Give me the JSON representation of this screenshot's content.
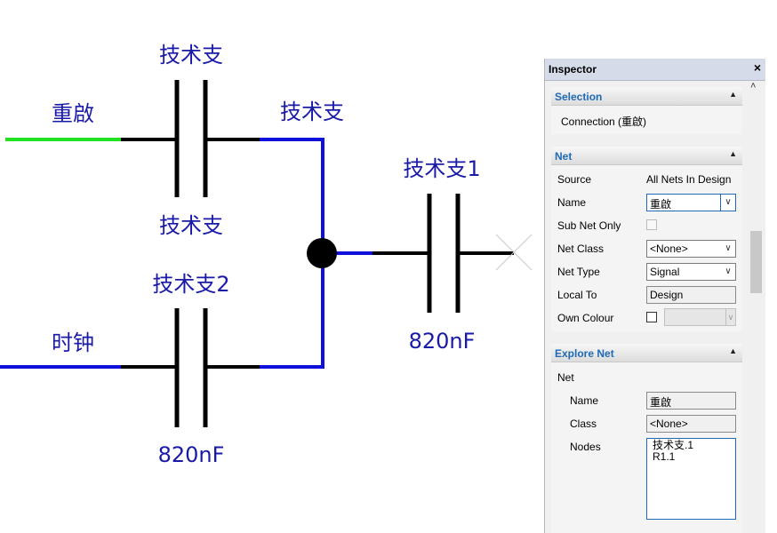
{
  "schematic": {
    "labels": {
      "top_cap_ref": "技术支",
      "top_cap_value": "技术支",
      "net_reset": "重啟",
      "net_top_right": "技术支",
      "mid_cap_ref": "技术支2",
      "mid_cap_value": "820nF",
      "net_clock": "时钟",
      "right_cap_ref": "技术支1",
      "right_cap_value": "820nF"
    },
    "colors": {
      "wire_green": "#22e022",
      "wire_blue": "#1010dd",
      "wire_black": "#000000",
      "label_blue": "#1a1aa8"
    }
  },
  "inspector": {
    "title": "Inspector",
    "close_glyph": "×",
    "scroll_up_glyph": "˄",
    "selection": {
      "header": "Selection",
      "collapse_glyph": "▲",
      "value": "Connection (重啟)"
    },
    "net": {
      "header": "Net",
      "collapse_glyph": "▲",
      "source_label": "Source",
      "source_value": "All Nets In Design",
      "name_label": "Name",
      "name_value": "重啟",
      "sub_net_only_label": "Sub Net Only",
      "sub_net_only_checked": false,
      "net_class_label": "Net Class",
      "net_class_value": "<None>",
      "net_type_label": "Net Type",
      "net_type_value": "Signal",
      "local_to_label": "Local To",
      "local_to_value": "Design",
      "own_colour_label": "Own Colour",
      "own_colour_checked": false,
      "dropdown_glyph": "∨"
    },
    "explore_net": {
      "header": "Explore Net",
      "collapse_glyph": "▲",
      "net_label": "Net",
      "name_label": "Name",
      "name_value": "重啟",
      "class_label": "Class",
      "class_value": "<None>",
      "nodes_label": "Nodes",
      "nodes": [
        "技术支.1",
        "R1.1"
      ]
    },
    "accent_color": "#1e6ab6"
  }
}
